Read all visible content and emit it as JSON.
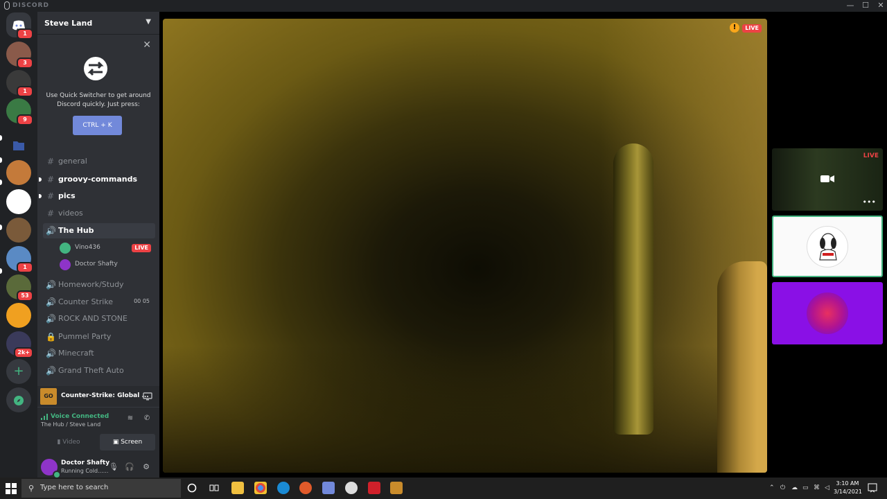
{
  "titlebar": {
    "brand": "DISCORD",
    "minimize": "—",
    "maximize": "☐",
    "close": "✕"
  },
  "servers": [
    {
      "name": "discord-home",
      "badge": "1",
      "color": "#7289da"
    },
    {
      "name": "server-1",
      "badge": "3",
      "color": "#8a5a4a"
    },
    {
      "name": "server-2",
      "badge": "1",
      "color": "#3a3a3a"
    },
    {
      "name": "server-3",
      "badge": "9",
      "color": "#3a7a44"
    },
    {
      "name": "folder",
      "badge": "",
      "color": "#3a5aa8"
    },
    {
      "name": "server-4",
      "badge": "",
      "color": "#c47a3a"
    },
    {
      "name": "server-5",
      "badge": "",
      "color": "#ffffff"
    },
    {
      "name": "server-6",
      "badge": "",
      "color": "#7a5a3a"
    },
    {
      "name": "server-7",
      "badge": "1",
      "color": "#5a8ac4"
    },
    {
      "name": "server-8",
      "badge": "53",
      "color": "#5a6a3a"
    },
    {
      "name": "server-9",
      "badge": "",
      "color": "#f0a020"
    },
    {
      "name": "server-10",
      "badge": "2k+",
      "color": "#3a3a5a"
    }
  ],
  "server": {
    "name": "Steve Land"
  },
  "quick_switcher": {
    "text": "Use Quick Switcher to get around Discord quickly. Just press:",
    "button": "CTRL + K"
  },
  "channels": [
    {
      "type": "text",
      "name": "general",
      "bright": false
    },
    {
      "type": "text",
      "name": "groovy-commands",
      "bright": true
    },
    {
      "type": "text",
      "name": "pics",
      "bright": true
    },
    {
      "type": "text",
      "name": "videos",
      "bright": false
    },
    {
      "type": "voice",
      "name": "The Hub",
      "bright": true
    }
  ],
  "voice_users": [
    {
      "name": "Vino436",
      "live": "LIVE"
    },
    {
      "name": "Doctor Shafty",
      "live": ""
    }
  ],
  "voice_channels": [
    {
      "type": "voice",
      "name": "Homework/Study"
    },
    {
      "type": "voice",
      "name": "Counter Strike",
      "timer": "00 05"
    },
    {
      "type": "voice",
      "name": "ROCK AND STONE"
    },
    {
      "type": "locked",
      "name": "Pummel Party"
    },
    {
      "type": "voice",
      "name": "Minecraft"
    },
    {
      "type": "voice",
      "name": "Grand Theft Auto"
    }
  ],
  "activity": {
    "icon": "GO",
    "game": "Counter-Strike: Global ..."
  },
  "voice": {
    "title": "Voice Connected",
    "sub": "The Hub / Steve Land",
    "video": "Video",
    "screen": "Screen"
  },
  "user": {
    "name": "Doctor Shafty",
    "status": "Running Cold......"
  },
  "stream": {
    "live": "LIVE",
    "warn": "!"
  },
  "tiles": {
    "live": "LIVE",
    "more": "•••"
  },
  "taskbar": {
    "search_placeholder": "Type here to search",
    "time": "3:10 AM",
    "date": "3/14/2021"
  }
}
